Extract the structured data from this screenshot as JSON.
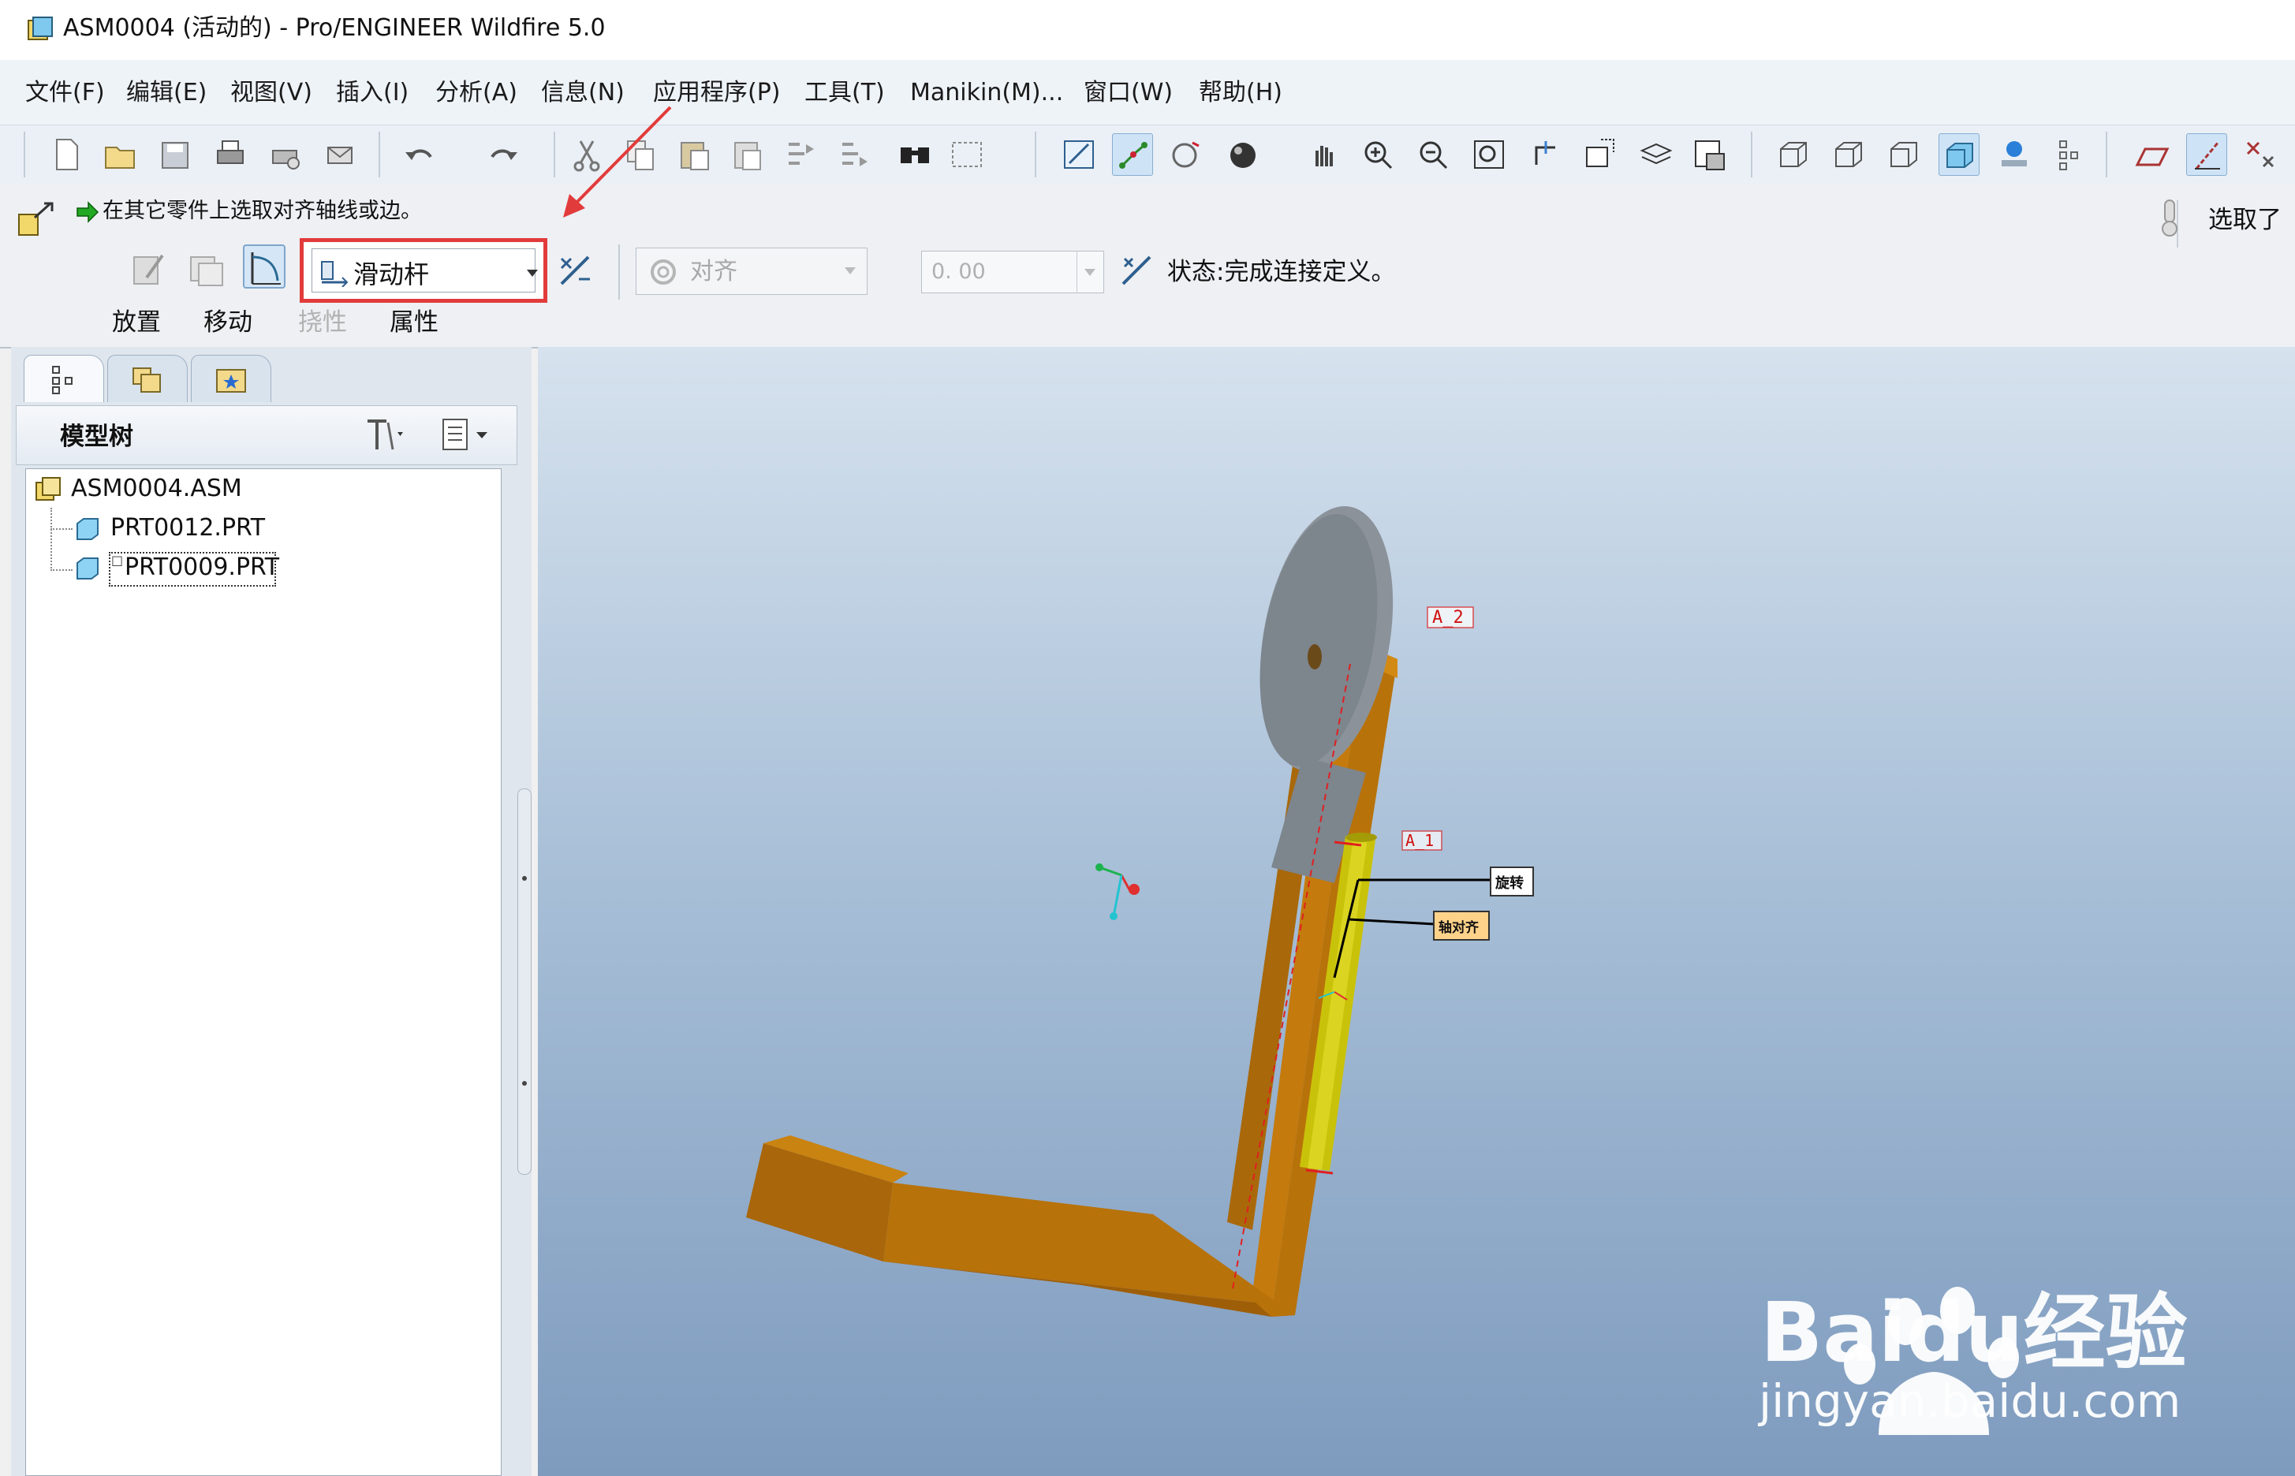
{
  "window": {
    "title": "ASM0004 (活动的) - Pro/ENGINEER Wildfire 5.0"
  },
  "menu": {
    "items": [
      "文件(F)",
      "编辑(E)",
      "视图(V)",
      "插入(I)",
      "分析(A)",
      "信息(N)",
      "应用程序(P)",
      "工具(T)",
      "Manikin(M)...",
      "窗口(W)",
      "帮助(H)"
    ]
  },
  "toolbar": {
    "icons": [
      "new-file-icon",
      "open-folder-icon",
      "save-icon",
      "print-icon",
      "quick-print-icon",
      "send-mail-icon",
      "undo-icon",
      "redo-icon",
      "cut-icon",
      "copy-icon",
      "paste-icon",
      "paste-special-icon",
      "regenerate-icon",
      "regen-manager-icon",
      "find-icon",
      "select-box-icon",
      "sketch-view-icon",
      "spin-center-icon",
      "orient-icon",
      "shaded-sphere-icon",
      "pan-hand-icon",
      "zoom-in-icon",
      "zoom-out-icon",
      "refit-icon",
      "reorient-icon",
      "named-views-icon",
      "layers-icon",
      "appearance-icon",
      "wireframe-icon",
      "hidden-line-icon",
      "no-hidden-icon",
      "shading-icon",
      "render-icon",
      "datum-display-icon",
      "datum-planes-icon",
      "datum-axes-icon",
      "coordinate-system-icon"
    ]
  },
  "prompt": {
    "text": "在其它零件上选取对齐轴线或边。"
  },
  "dashboard": {
    "connection_type": "滑动杆",
    "constraint_type": "对齐",
    "offset_value": "0. 00",
    "status": "状态:完成连接定义。",
    "tabs": [
      "放置",
      "移动",
      "挠性",
      "属性"
    ],
    "select_label": "选取了",
    "highlight_color": "#e23b3b"
  },
  "model_tree": {
    "title": "模型树",
    "nodes": [
      {
        "label": "ASM0004.ASM",
        "level": 0,
        "selected": false
      },
      {
        "label": "PRT0012.PRT",
        "level": 1,
        "selected": false
      },
      {
        "label": "PRT0009.PRT",
        "level": 1,
        "selected": true
      }
    ]
  },
  "viewport": {
    "datum_labels": [
      "A_2",
      "A_1"
    ],
    "constraint_tags": [
      "旋转",
      "轴对齐"
    ],
    "part_colors": {
      "bracket": "#b8720a",
      "pin": "#c9c20a",
      "lug": "#7d858d"
    }
  },
  "watermark": {
    "brand": "Baidu经验",
    "url": "jingyan.baidu.com"
  }
}
